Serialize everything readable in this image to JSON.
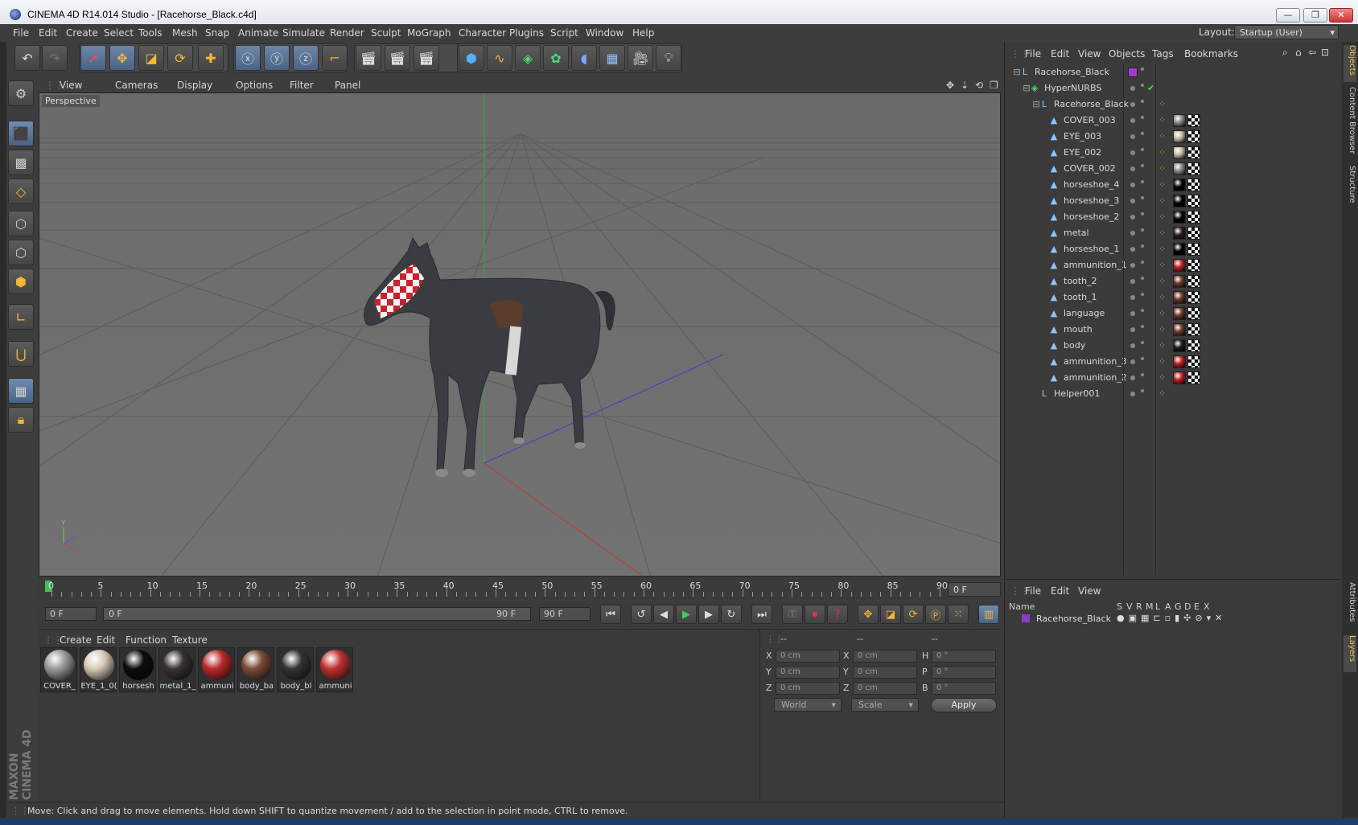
{
  "window": {
    "title": "CINEMA 4D R14.014 Studio - [Racehorse_Black.c4d]"
  },
  "menus": [
    "File",
    "Edit",
    "Create",
    "Select",
    "Tools",
    "Mesh",
    "Snap",
    "Animate",
    "Simulate",
    "Render",
    "Sculpt",
    "MoGraph",
    "Character",
    "Plugins",
    "Script",
    "Window",
    "Help"
  ],
  "layout": {
    "label": "Layout:",
    "value": "Startup (User)"
  },
  "viewport": {
    "menus": [
      "View",
      "Cameras",
      "Display",
      "Options",
      "Filter",
      "Panel"
    ],
    "camera": "Perspective"
  },
  "timeline": {
    "ticks": [
      "0",
      "5",
      "10",
      "15",
      "20",
      "25",
      "30",
      "35",
      "40",
      "45",
      "50",
      "55",
      "60",
      "65",
      "70",
      "75",
      "80",
      "85",
      "90"
    ],
    "current": "0 F"
  },
  "transport": {
    "start": "0 F",
    "range_start": "0 F",
    "range_end": "90 F",
    "end": "90 F"
  },
  "materials": {
    "menus": [
      "Create",
      "Edit",
      "Function",
      "Texture"
    ],
    "items": [
      {
        "label": "COVER_",
        "color": "#9a9a9a"
      },
      {
        "label": "EYE_1_0(",
        "color": "#d8cbb8"
      },
      {
        "label": "horsesh",
        "color": "#0c0c0c"
      },
      {
        "label": "metal_1_",
        "color": "#3b3030"
      },
      {
        "label": "ammuni",
        "color": "#b82a2a"
      },
      {
        "label": "body_ba",
        "color": "#7a4a38"
      },
      {
        "label": "body_bl",
        "color": "#333333"
      },
      {
        "label": "ammuni",
        "color": "#c03030"
      }
    ]
  },
  "coords": {
    "headers": [
      "--",
      "--",
      "--"
    ],
    "rows": [
      {
        "a": "X",
        "av": "0 cm",
        "b": "X",
        "bv": "0 cm",
        "c": "H",
        "cv": "0 °"
      },
      {
        "a": "Y",
        "av": "0 cm",
        "b": "Y",
        "bv": "0 cm",
        "c": "P",
        "cv": "0 °"
      },
      {
        "a": "Z",
        "av": "0 cm",
        "b": "Z",
        "bv": "0 cm",
        "c": "B",
        "cv": "0 °"
      }
    ],
    "mode1": "World",
    "mode2": "Scale",
    "apply": "Apply"
  },
  "status": "Move: Click and drag to move elements. Hold down SHIFT to quantize movement / add to the selection in point mode, CTRL to remove.",
  "objects": {
    "menus": [
      "File",
      "Edit",
      "View",
      "Objects",
      "Tags",
      "Bookmarks"
    ],
    "rows": [
      "Racehorse_Black",
      "HyperNURBS",
      "Racehorse_Black",
      "COVER_003",
      "EYE_003",
      "EYE_002",
      "COVER_002",
      "horseshoe_4",
      "horseshoe_3",
      "horseshoe_2",
      "metal",
      "horseshoe_1",
      "ammunition_1",
      "tooth_2",
      "tooth_1",
      "language",
      "mouth",
      "body",
      "ammunition_3",
      "ammunition_2",
      "Helper001"
    ]
  },
  "layers": {
    "menus": [
      "File",
      "Edit",
      "View"
    ],
    "cols": [
      "Name",
      "S",
      "V",
      "R",
      "M",
      "L",
      "A",
      "G",
      "D",
      "E",
      "X"
    ],
    "row": "Racehorse_Black"
  },
  "sidetabs": [
    "Objects",
    "Content Browser",
    "Structure",
    "Attributes",
    "Layers"
  ],
  "brand": "MAXON CINEMA 4D"
}
